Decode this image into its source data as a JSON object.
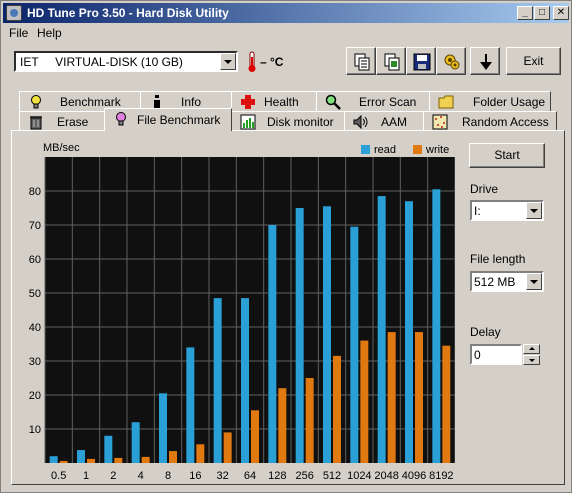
{
  "window": {
    "title": "HD Tune Pro 3.50 - Hard Disk Utility"
  },
  "titlebar_buttons": {
    "minimize": "_",
    "maximize": "□",
    "close": "✕"
  },
  "menu": {
    "file": "File",
    "help": "Help"
  },
  "toolbar": {
    "drive_selected": "IET     VIRTUAL-DISK (10 GB)",
    "temperature": "– °C",
    "exit_label": "Exit",
    "buttons": [
      "copy-info-icon",
      "copy-screenshot-icon",
      "save-icon",
      "options-icon",
      "download-icon"
    ]
  },
  "tabs_top": [
    "Benchmark",
    "Info",
    "Health",
    "Error Scan",
    "Folder Usage"
  ],
  "tabs_bottom": [
    "Erase",
    "File Benchmark",
    "Disk monitor",
    "AAM",
    "Random Access"
  ],
  "active_tab": "File Benchmark",
  "side": {
    "start_label": "Start",
    "drive_label": "Drive",
    "drive_value": "I:",
    "file_length_label": "File length",
    "file_length_value": "512 MB",
    "delay_label": "Delay",
    "delay_value": "0"
  },
  "colors": {
    "read": "#2aa0d6",
    "write": "#e07a10",
    "plot_bg": "#101010",
    "grid": "#606060"
  },
  "chart_data": {
    "type": "bar",
    "ylabel": "MB/sec",
    "ylim": [
      0,
      90
    ],
    "yticks": [
      10,
      20,
      30,
      40,
      50,
      60,
      70,
      80
    ],
    "categories": [
      "0.5",
      "1",
      "2",
      "4",
      "8",
      "16",
      "32",
      "64",
      "128",
      "256",
      "512",
      "1024",
      "2048",
      "4096",
      "8192"
    ],
    "legend_position": "top-right",
    "series": [
      {
        "name": "read",
        "values": [
          2,
          3.8,
          8,
          12,
          20.5,
          34,
          48.5,
          48.5,
          70,
          75,
          75.5,
          69.5,
          78.5,
          77,
          80.5
        ]
      },
      {
        "name": "write",
        "values": [
          0.6,
          1.2,
          1.5,
          1.8,
          3.5,
          5.5,
          9,
          15.5,
          22,
          25,
          31.5,
          36,
          38.5,
          38.5,
          34.5
        ]
      }
    ]
  }
}
